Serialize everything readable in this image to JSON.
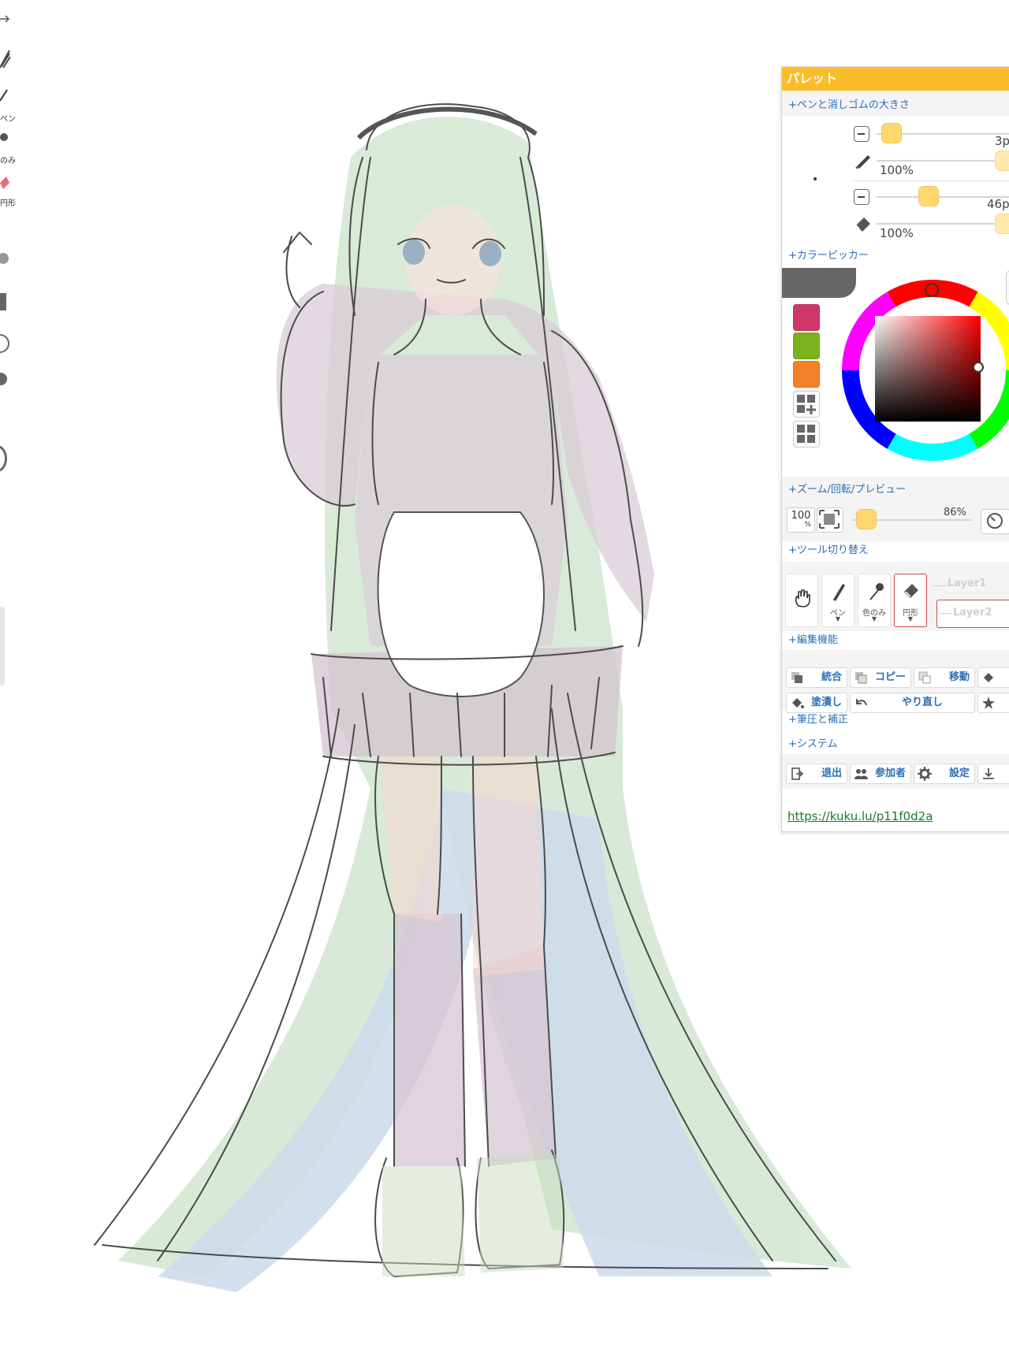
{
  "left_toolbar": {
    "pen_label": "ペン",
    "color_only_label": "のみ",
    "circle_label": "円形"
  },
  "palette": {
    "title": "パレット",
    "pen_eraser_section": "+ペンと消しゴムの大きさ",
    "pen_size": "3p",
    "pen_opacity": "100%",
    "eraser_size": "46p",
    "eraser_opacity": "100%",
    "color_picker_section": "+カラーピッカー",
    "swatches": [
      "#d03768",
      "#7bb31c",
      "#f5802a"
    ],
    "zoom_section": "+ズーム/回転/プレビュー",
    "zoom_reset_label": "100",
    "zoom_reset_unit": "%",
    "zoom_value": "86%",
    "tool_switch_section": "+ツール切り替え",
    "tools": {
      "pen_label": "ペン",
      "color_only_label": "色のみ",
      "circle_label": "円形"
    },
    "layer1_label": "Layer1",
    "layer2_label": "Layer2",
    "edit_section": "+編集機能",
    "edit_buttons_row1": [
      "統合",
      "コピー",
      "移動"
    ],
    "edit_buttons_row2": [
      "塗潰し",
      "やり直し"
    ],
    "pressure_section": "+筆圧と補正",
    "system_section": "+システム",
    "system_buttons": [
      "退出",
      "参加者",
      "設定"
    ],
    "room_url": "https://kuku.lu/p11f0d2a"
  }
}
